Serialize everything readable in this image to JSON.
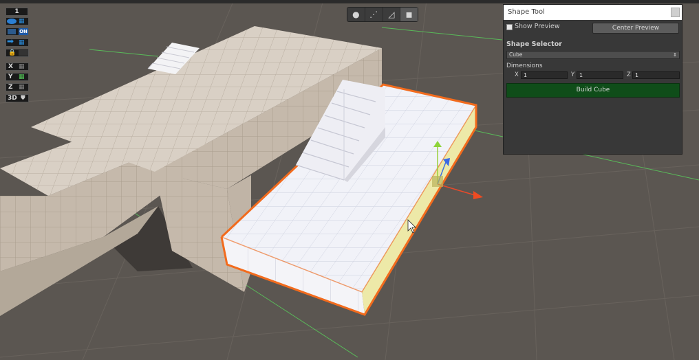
{
  "scene_toolbar": {
    "layer_number": "1",
    "snap_on_label": "ON",
    "axis_x": "X",
    "axis_y": "Y",
    "axis_z": "Z",
    "view_mode": "3D"
  },
  "shape_tool": {
    "title": "Shape Tool",
    "show_preview_label": "Show Preview",
    "center_preview_label": "Center Preview",
    "section_title": "Shape Selector",
    "shape_selected": "Cube",
    "dimensions_label": "Dimensions",
    "dim_x_label": "X",
    "dim_x_value": "1",
    "dim_y_label": "Y",
    "dim_y_value": "1",
    "dim_z_label": "Z",
    "dim_z_value": "1",
    "build_label": "Build Cube"
  },
  "colors": {
    "selection_outline": "#f26b1d",
    "build_button": "#0f4d19",
    "grid_line": "#59d35c"
  }
}
